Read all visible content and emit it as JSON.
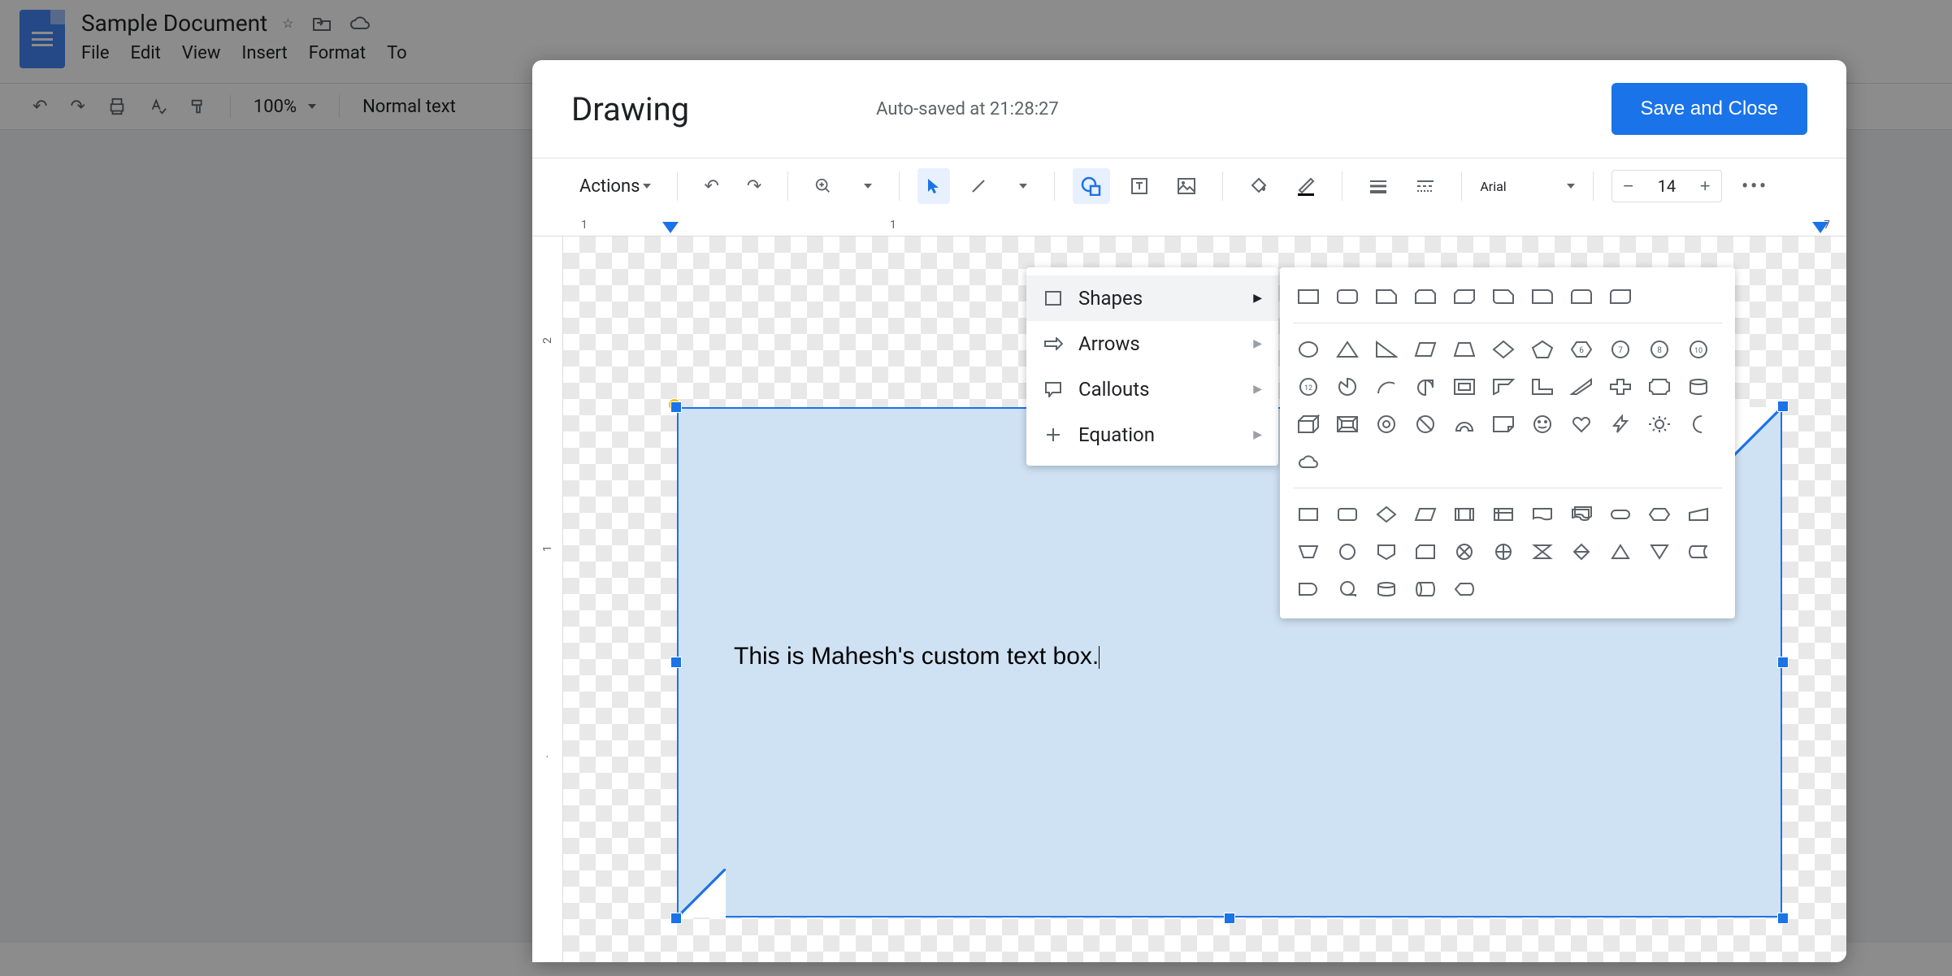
{
  "docs": {
    "title": "Sample Document",
    "menus": [
      "File",
      "Edit",
      "View",
      "Insert",
      "Format",
      "To"
    ],
    "zoom": "100%",
    "style": "Normal text"
  },
  "modal": {
    "title": "Drawing",
    "status": "Auto-saved at 21:28:27",
    "save_label": "Save and Close",
    "actions_label": "Actions",
    "font": "Arial",
    "font_size": "14",
    "ruler_marks": [
      "1",
      "1",
      "7"
    ],
    "v_ruler": [
      "2",
      "1"
    ]
  },
  "shape_menu": {
    "items": [
      {
        "label": "Shapes",
        "icon": "square"
      },
      {
        "label": "Arrows",
        "icon": "arrow"
      },
      {
        "label": "Callouts",
        "icon": "callout"
      },
      {
        "label": "Equation",
        "icon": "plus"
      }
    ]
  },
  "textbox": {
    "content": "This is Mahesh's custom text box."
  }
}
